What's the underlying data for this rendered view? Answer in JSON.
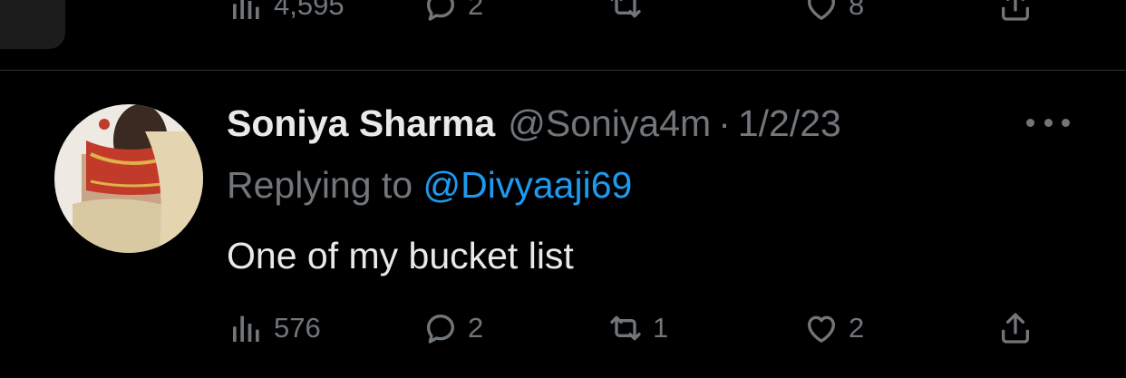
{
  "previous_tweet": {
    "views": "4,595",
    "replies": "2",
    "retweets": "",
    "likes": "8"
  },
  "tweet": {
    "author_name": "Soniya Sharma",
    "handle": "@Soniya4m",
    "separator": "·",
    "date": "1/2/23",
    "replying_prefix": "Replying to",
    "replying_to": "@Divyaaji69",
    "text": "One of my bucket list",
    "stats": {
      "views": "576",
      "replies": "2",
      "retweets": "1",
      "likes": "2"
    }
  },
  "colors": {
    "background": "#000000",
    "text": "#e7e9ea",
    "muted": "#71767b",
    "link": "#1d9bf0",
    "divider": "#2f3336"
  },
  "icons": [
    "views-icon",
    "reply-icon",
    "retweet-icon",
    "like-icon",
    "share-icon",
    "more-icon"
  ]
}
